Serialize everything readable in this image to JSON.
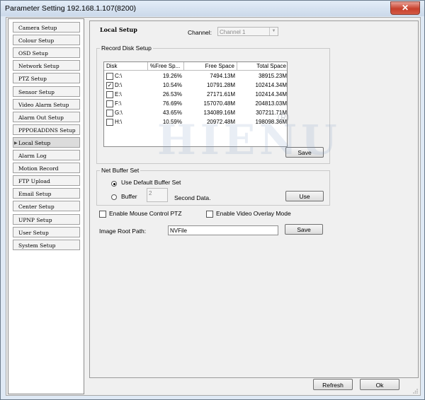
{
  "window": {
    "title": "Parameter Setting 192.168.1.107(8200)",
    "close_label": "✕"
  },
  "sidebar": {
    "items": [
      "Camera Setup",
      "Colour Setup",
      "OSD Setup",
      "Network Setup",
      "PTZ Setup",
      "Sensor Setup",
      "Video Alarm Setup",
      "Alarm Out Setup",
      "PPPOEADDNS Setup",
      "Local Setup",
      "Alarm Log",
      "Motion Record",
      "FTP Upload",
      "Email Setup",
      "Center Setup",
      "UPNP Setup",
      "User Setup",
      "System Setup"
    ],
    "active_index": 9
  },
  "local_setup": {
    "heading": "Local Setup",
    "channel_label": "Channel:",
    "channel_value": "Channel 1",
    "record_disk": {
      "legend": "Record Disk Setup",
      "columns": [
        "Disk",
        "%Free Sp...",
        "Free Space",
        "Total Space"
      ],
      "rows": [
        {
          "disk": "C:\\",
          "checked": false,
          "free_pct": "19.26%",
          "free": "7494.13M",
          "total": "38915.23M"
        },
        {
          "disk": "D:\\",
          "checked": true,
          "free_pct": "10.54%",
          "free": "10791.28M",
          "total": "102414.34M"
        },
        {
          "disk": "E:\\",
          "checked": false,
          "free_pct": "26.53%",
          "free": "27171.61M",
          "total": "102414.34M"
        },
        {
          "disk": "F:\\",
          "checked": false,
          "free_pct": "76.69%",
          "free": "157070.48M",
          "total": "204813.03M"
        },
        {
          "disk": "G:\\",
          "checked": false,
          "free_pct": "43.65%",
          "free": "134089.16M",
          "total": "307211.71M"
        },
        {
          "disk": "H:\\",
          "checked": false,
          "free_pct": "10.59%",
          "free": "20972.48M",
          "total": "198098.36M"
        }
      ],
      "save_label": "Save"
    },
    "net_buffer": {
      "legend": "Net Buffer Set",
      "default_label": "Use Default Buffer Set",
      "buffer_label": "Buffer",
      "buffer_value": "2",
      "second_label": "Second Data.",
      "use_label": "Use",
      "selected": "default"
    },
    "mouse_ptz_label": "Enable Mouse Control PTZ",
    "video_overlay_label": "Enable Video Overlay Mode",
    "image_root_label": "Image Root Path:",
    "image_root_value": "NVFile",
    "image_save_label": "Save"
  },
  "watermark": {
    "text": "HIENU",
    "reg_mark": "®"
  },
  "footer": {
    "refresh_label": "Refresh",
    "ok_label": "Ok"
  }
}
